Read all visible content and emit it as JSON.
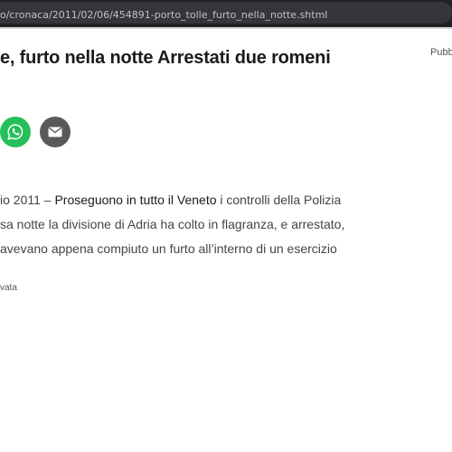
{
  "browser": {
    "url": "o/cronaca/2011/02/06/454891-porto_tolle_furto_nella_notte.shtml"
  },
  "article": {
    "headline": "e, furto nella notte Arrestati due romeni",
    "published_label": "Pubb",
    "share": {
      "whatsapp_icon": "whatsapp-icon",
      "mail_icon": "mail-icon"
    },
    "body": {
      "line1_prefix": "io 2011 – ",
      "line1_link": "Proseguono in tutto il Veneto",
      "line1_suffix": " i controlli della Polizia",
      "line2": "sa notte la divisione di Adria ha colto in flagranza, e arrestato,",
      "line3": "avevano appena compiuto un furto all’interno di un esercizio"
    },
    "rights": "vata"
  }
}
